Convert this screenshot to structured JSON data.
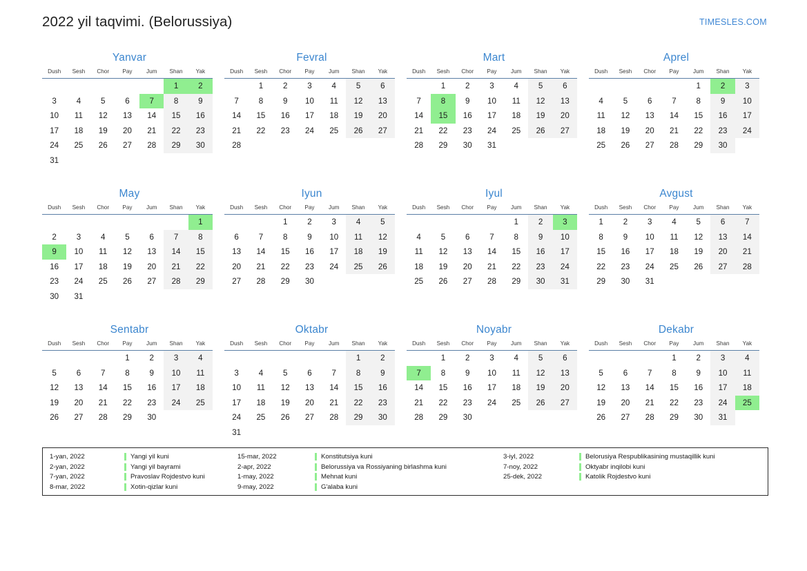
{
  "header": {
    "title": "2022 yil taqvimi. (Belorussiya)",
    "brand": "TIMESLES.COM"
  },
  "colors": {
    "holiday": "#90ee90",
    "weekend": "#f2f2f2",
    "month_title": "#3b86cf",
    "brand": "#3f87d4",
    "header_rule": "#5b7fa6"
  },
  "weekdays": [
    "Dush",
    "Sesh",
    "Chor",
    "Pay",
    "Jum",
    "Shan",
    "Yak"
  ],
  "months": [
    {
      "name": "Yanvar",
      "holidays": [
        1,
        2,
        7
      ],
      "weeks": [
        [
          null,
          null,
          null,
          null,
          null,
          1,
          2
        ],
        [
          3,
          4,
          5,
          6,
          7,
          8,
          9
        ],
        [
          10,
          11,
          12,
          13,
          14,
          15,
          16
        ],
        [
          17,
          18,
          19,
          20,
          21,
          22,
          23
        ],
        [
          24,
          25,
          26,
          27,
          28,
          29,
          30
        ],
        [
          31,
          null,
          null,
          null,
          null,
          null,
          null
        ]
      ]
    },
    {
      "name": "Fevral",
      "holidays": [],
      "weeks": [
        [
          null,
          1,
          2,
          3,
          4,
          5,
          6
        ],
        [
          7,
          8,
          9,
          10,
          11,
          12,
          13
        ],
        [
          14,
          15,
          16,
          17,
          18,
          19,
          20
        ],
        [
          21,
          22,
          23,
          24,
          25,
          26,
          27
        ],
        [
          28,
          null,
          null,
          null,
          null,
          null,
          null
        ]
      ]
    },
    {
      "name": "Mart",
      "holidays": [
        8,
        15
      ],
      "weeks": [
        [
          null,
          1,
          2,
          3,
          4,
          5,
          6
        ],
        [
          7,
          8,
          9,
          10,
          11,
          12,
          13
        ],
        [
          14,
          15,
          16,
          17,
          18,
          19,
          20
        ],
        [
          21,
          22,
          23,
          24,
          25,
          26,
          27
        ],
        [
          28,
          29,
          30,
          31,
          null,
          null,
          null
        ]
      ]
    },
    {
      "name": "Aprel",
      "holidays": [
        2
      ],
      "weeks": [
        [
          null,
          null,
          null,
          null,
          1,
          2,
          3
        ],
        [
          4,
          5,
          6,
          7,
          8,
          9,
          10
        ],
        [
          11,
          12,
          13,
          14,
          15,
          16,
          17
        ],
        [
          18,
          19,
          20,
          21,
          22,
          23,
          24
        ],
        [
          25,
          26,
          27,
          28,
          29,
          30,
          null
        ]
      ]
    },
    {
      "name": "May",
      "holidays": [
        1,
        9
      ],
      "weeks": [
        [
          null,
          null,
          null,
          null,
          null,
          null,
          1
        ],
        [
          2,
          3,
          4,
          5,
          6,
          7,
          8
        ],
        [
          9,
          10,
          11,
          12,
          13,
          14,
          15
        ],
        [
          16,
          17,
          18,
          19,
          20,
          21,
          22
        ],
        [
          23,
          24,
          25,
          26,
          27,
          28,
          29
        ],
        [
          30,
          31,
          null,
          null,
          null,
          null,
          null
        ]
      ]
    },
    {
      "name": "Iyun",
      "holidays": [],
      "weeks": [
        [
          null,
          null,
          1,
          2,
          3,
          4,
          5
        ],
        [
          6,
          7,
          8,
          9,
          10,
          11,
          12
        ],
        [
          13,
          14,
          15,
          16,
          17,
          18,
          19
        ],
        [
          20,
          21,
          22,
          23,
          24,
          25,
          26
        ],
        [
          27,
          28,
          29,
          30,
          null,
          null,
          null
        ]
      ]
    },
    {
      "name": "Iyul",
      "holidays": [
        3
      ],
      "weeks": [
        [
          null,
          null,
          null,
          null,
          1,
          2,
          3
        ],
        [
          4,
          5,
          6,
          7,
          8,
          9,
          10
        ],
        [
          11,
          12,
          13,
          14,
          15,
          16,
          17
        ],
        [
          18,
          19,
          20,
          21,
          22,
          23,
          24
        ],
        [
          25,
          26,
          27,
          28,
          29,
          30,
          31
        ]
      ]
    },
    {
      "name": "Avgust",
      "holidays": [],
      "weeks": [
        [
          1,
          2,
          3,
          4,
          5,
          6,
          7
        ],
        [
          8,
          9,
          10,
          11,
          12,
          13,
          14
        ],
        [
          15,
          16,
          17,
          18,
          19,
          20,
          21
        ],
        [
          22,
          23,
          24,
          25,
          26,
          27,
          28
        ],
        [
          29,
          30,
          31,
          null,
          null,
          null,
          null
        ]
      ]
    },
    {
      "name": "Sentabr",
      "holidays": [],
      "weeks": [
        [
          null,
          null,
          null,
          1,
          2,
          3,
          4
        ],
        [
          5,
          6,
          7,
          8,
          9,
          10,
          11
        ],
        [
          12,
          13,
          14,
          15,
          16,
          17,
          18
        ],
        [
          19,
          20,
          21,
          22,
          23,
          24,
          25
        ],
        [
          26,
          27,
          28,
          29,
          30,
          null,
          null
        ]
      ]
    },
    {
      "name": "Oktabr",
      "holidays": [],
      "weeks": [
        [
          null,
          null,
          null,
          null,
          null,
          1,
          2
        ],
        [
          3,
          4,
          5,
          6,
          7,
          8,
          9
        ],
        [
          10,
          11,
          12,
          13,
          14,
          15,
          16
        ],
        [
          17,
          18,
          19,
          20,
          21,
          22,
          23
        ],
        [
          24,
          25,
          26,
          27,
          28,
          29,
          30
        ],
        [
          31,
          null,
          null,
          null,
          null,
          null,
          null
        ]
      ]
    },
    {
      "name": "Noyabr",
      "holidays": [
        7
      ],
      "weeks": [
        [
          null,
          1,
          2,
          3,
          4,
          5,
          6
        ],
        [
          7,
          8,
          9,
          10,
          11,
          12,
          13
        ],
        [
          14,
          15,
          16,
          17,
          18,
          19,
          20
        ],
        [
          21,
          22,
          23,
          24,
          25,
          26,
          27
        ],
        [
          28,
          29,
          30,
          null,
          null,
          null,
          null
        ]
      ]
    },
    {
      "name": "Dekabr",
      "holidays": [
        25
      ],
      "weeks": [
        [
          null,
          null,
          null,
          1,
          2,
          3,
          4
        ],
        [
          5,
          6,
          7,
          8,
          9,
          10,
          11
        ],
        [
          12,
          13,
          14,
          15,
          16,
          17,
          18
        ],
        [
          19,
          20,
          21,
          22,
          23,
          24,
          25
        ],
        [
          26,
          27,
          28,
          29,
          30,
          31,
          null
        ]
      ]
    }
  ],
  "legend": {
    "columns": [
      [
        {
          "date": "1-yan, 2022",
          "name": "Yangi yil kuni"
        },
        {
          "date": "2-yan, 2022",
          "name": "Yangi yil bayrami"
        },
        {
          "date": "7-yan, 2022",
          "name": "Pravoslav Rojdestvo kuni"
        },
        {
          "date": "8-mar, 2022",
          "name": "Xotin-qizlar kuni"
        }
      ],
      [
        {
          "date": "15-mar, 2022",
          "name": "Konstitutsiya kuni"
        },
        {
          "date": "2-apr, 2022",
          "name": "Belorussiya va Rossiyaning birlashma kuni"
        },
        {
          "date": "1-may, 2022",
          "name": "Mehnat kuni"
        },
        {
          "date": "9-may, 2022",
          "name": "G'alaba kuni"
        }
      ],
      [
        {
          "date": "3-iyl, 2022",
          "name": "Belorusiya Respublikasining mustaqillik kuni"
        },
        {
          "date": "7-noy, 2022",
          "name": "Oktyabr inqilobi kuni"
        },
        {
          "date": "25-dek, 2022",
          "name": "Katolik Rojdestvo kuni"
        }
      ]
    ]
  }
}
